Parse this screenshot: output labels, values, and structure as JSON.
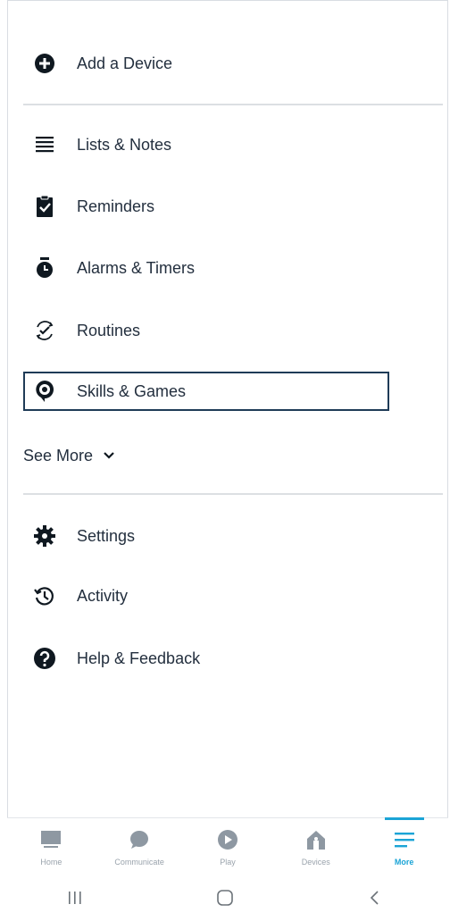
{
  "menu": {
    "add_device": "Add a Device",
    "items": [
      {
        "label": "Lists & Notes",
        "icon": "list-icon"
      },
      {
        "label": "Reminders",
        "icon": "clipboard-check-icon"
      },
      {
        "label": "Alarms & Timers",
        "icon": "alarm-clock-icon"
      },
      {
        "label": "Routines",
        "icon": "routine-check-icon"
      },
      {
        "label": "Skills & Games",
        "icon": "skills-pin-icon",
        "selected": true
      }
    ],
    "see_more": "See More",
    "secondary": [
      {
        "label": "Settings",
        "icon": "gear-icon"
      },
      {
        "label": "Activity",
        "icon": "history-icon"
      },
      {
        "label": "Help & Feedback",
        "icon": "help-icon"
      }
    ]
  },
  "tabbar": {
    "tabs": [
      {
        "label": "Home",
        "icon": "home-icon"
      },
      {
        "label": "Communicate",
        "icon": "chat-bubble-icon"
      },
      {
        "label": "Play",
        "icon": "play-icon"
      },
      {
        "label": "Devices",
        "icon": "devices-house-icon"
      },
      {
        "label": "More",
        "icon": "hamburger-menu-icon",
        "active": true
      }
    ]
  },
  "colors": {
    "text": "#232f3e",
    "accent": "#1ba4d6",
    "selected_border": "#1f3b57",
    "inactive_tab": "#9aa3ac"
  }
}
